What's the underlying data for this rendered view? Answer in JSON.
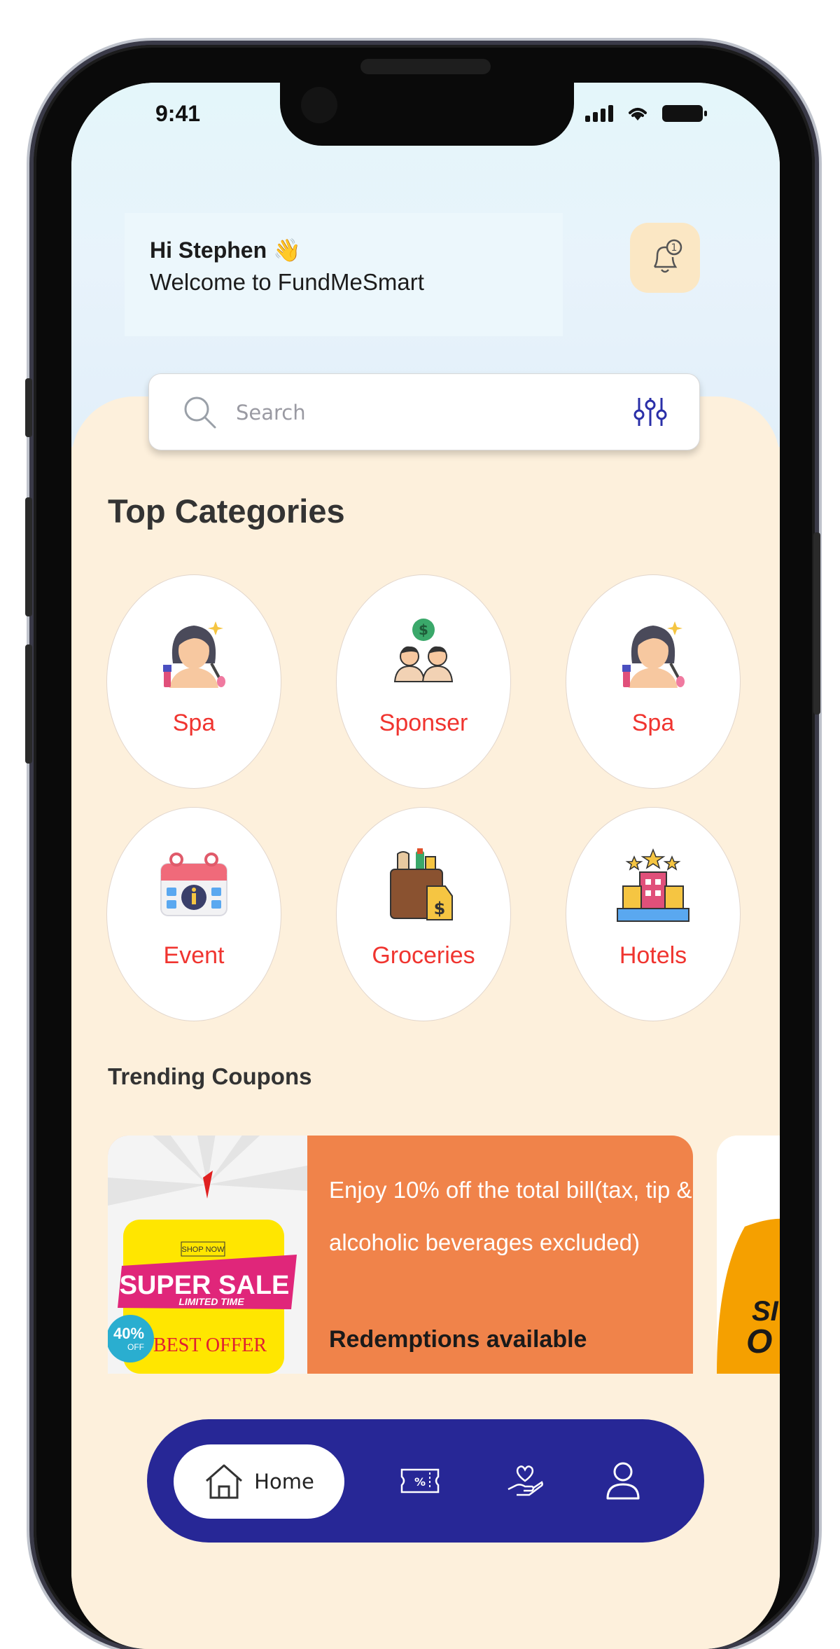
{
  "status_bar": {
    "time": "9:41"
  },
  "header": {
    "greeting": "Hi Stephen 👋",
    "subtitle": "Welcome to FundMeSmart",
    "notification_count": "1"
  },
  "search": {
    "placeholder": "Search"
  },
  "categories": {
    "title": "Top Categories",
    "items": [
      {
        "label": "Spa",
        "icon": "spa-woman-icon"
      },
      {
        "label": "Sponser",
        "icon": "sponsor-icon"
      },
      {
        "label": "Spa",
        "icon": "spa-woman-icon"
      },
      {
        "label": "Event",
        "icon": "calendar-event-icon"
      },
      {
        "label": "Groceries",
        "icon": "grocery-bag-icon"
      },
      {
        "label": "Hotels",
        "icon": "hotel-icon"
      }
    ]
  },
  "trending": {
    "title": "Trending Coupons",
    "coupon": {
      "description": "Enjoy 10% off the total bill(tax, tip & alcoholic beverages excluded)",
      "redemptions": "Redemptions available",
      "image_text": {
        "tag": "SHOP NOW",
        "headline": "SUPER SALE",
        "sub": "LIMITED TIME",
        "badge_pct": "40%",
        "badge_off": "OFF",
        "offer": "BEST OFFER"
      }
    },
    "next_coupon_text": {
      "line1": "SI",
      "line2": "O"
    }
  },
  "bottom_nav": {
    "home_label": "Home",
    "items": [
      "coupon-icon",
      "charity-icon",
      "profile-icon"
    ]
  },
  "colors": {
    "accent": "#f0342f",
    "nav_bg": "#272796",
    "coupon_bg": "#f0834a",
    "panel_bg": "#fdf0dc"
  }
}
